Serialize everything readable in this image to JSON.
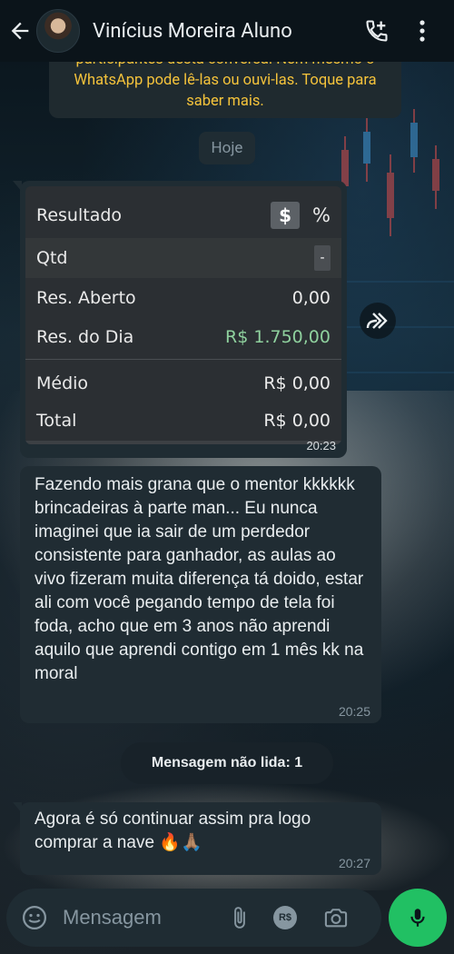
{
  "header": {
    "contact_name": "Vinícius Moreira Aluno"
  },
  "notice": {
    "text_line1": "participantes desta conversa. Nem mesmo o",
    "text_line2": "WhatsApp pode lê-las ou ouvi-las. Toque para",
    "text_line3": "saber mais."
  },
  "date_chip": "Hoje",
  "image_message": {
    "panel": {
      "header_label": "Resultado",
      "currency_button": "$",
      "percent_button": "%",
      "rows": [
        {
          "label": "Qtd",
          "value": "-"
        },
        {
          "label": "Res. Aberto",
          "value": "0,00"
        },
        {
          "label": "Res. do Dia",
          "value": "R$ 1.750,00"
        },
        {
          "label": "Médio",
          "value": "R$ 0,00"
        },
        {
          "label": "Total",
          "value": "R$ 0,00"
        }
      ]
    },
    "time": "20:23",
    "colors": {
      "positive": "#8fd19e"
    }
  },
  "messages": [
    {
      "text": "Fazendo mais grana que o mentor kkkkkk brincadeiras à parte man... Eu nunca imaginei que ia sair de um perdedor consistente para ganhador, as aulas ao vivo fizeram muita diferença tá doido, estar ali com você pegando tempo de tela foi foda, acho que em 3 anos não aprendi aquilo que aprendi contigo em 1 mês kk na moral",
      "time": "20:25"
    },
    {
      "text": "Agora é só continuar assim pra logo comprar a nave 🔥🙏🏽",
      "time": "20:27"
    }
  ],
  "unread_label": "Mensagem não lida: 1",
  "input": {
    "placeholder": "Mensagem",
    "money_icon_text": "R$"
  },
  "colors": {
    "accent": "#21c063",
    "bubble": "#202c33",
    "header": "#0b141a"
  }
}
